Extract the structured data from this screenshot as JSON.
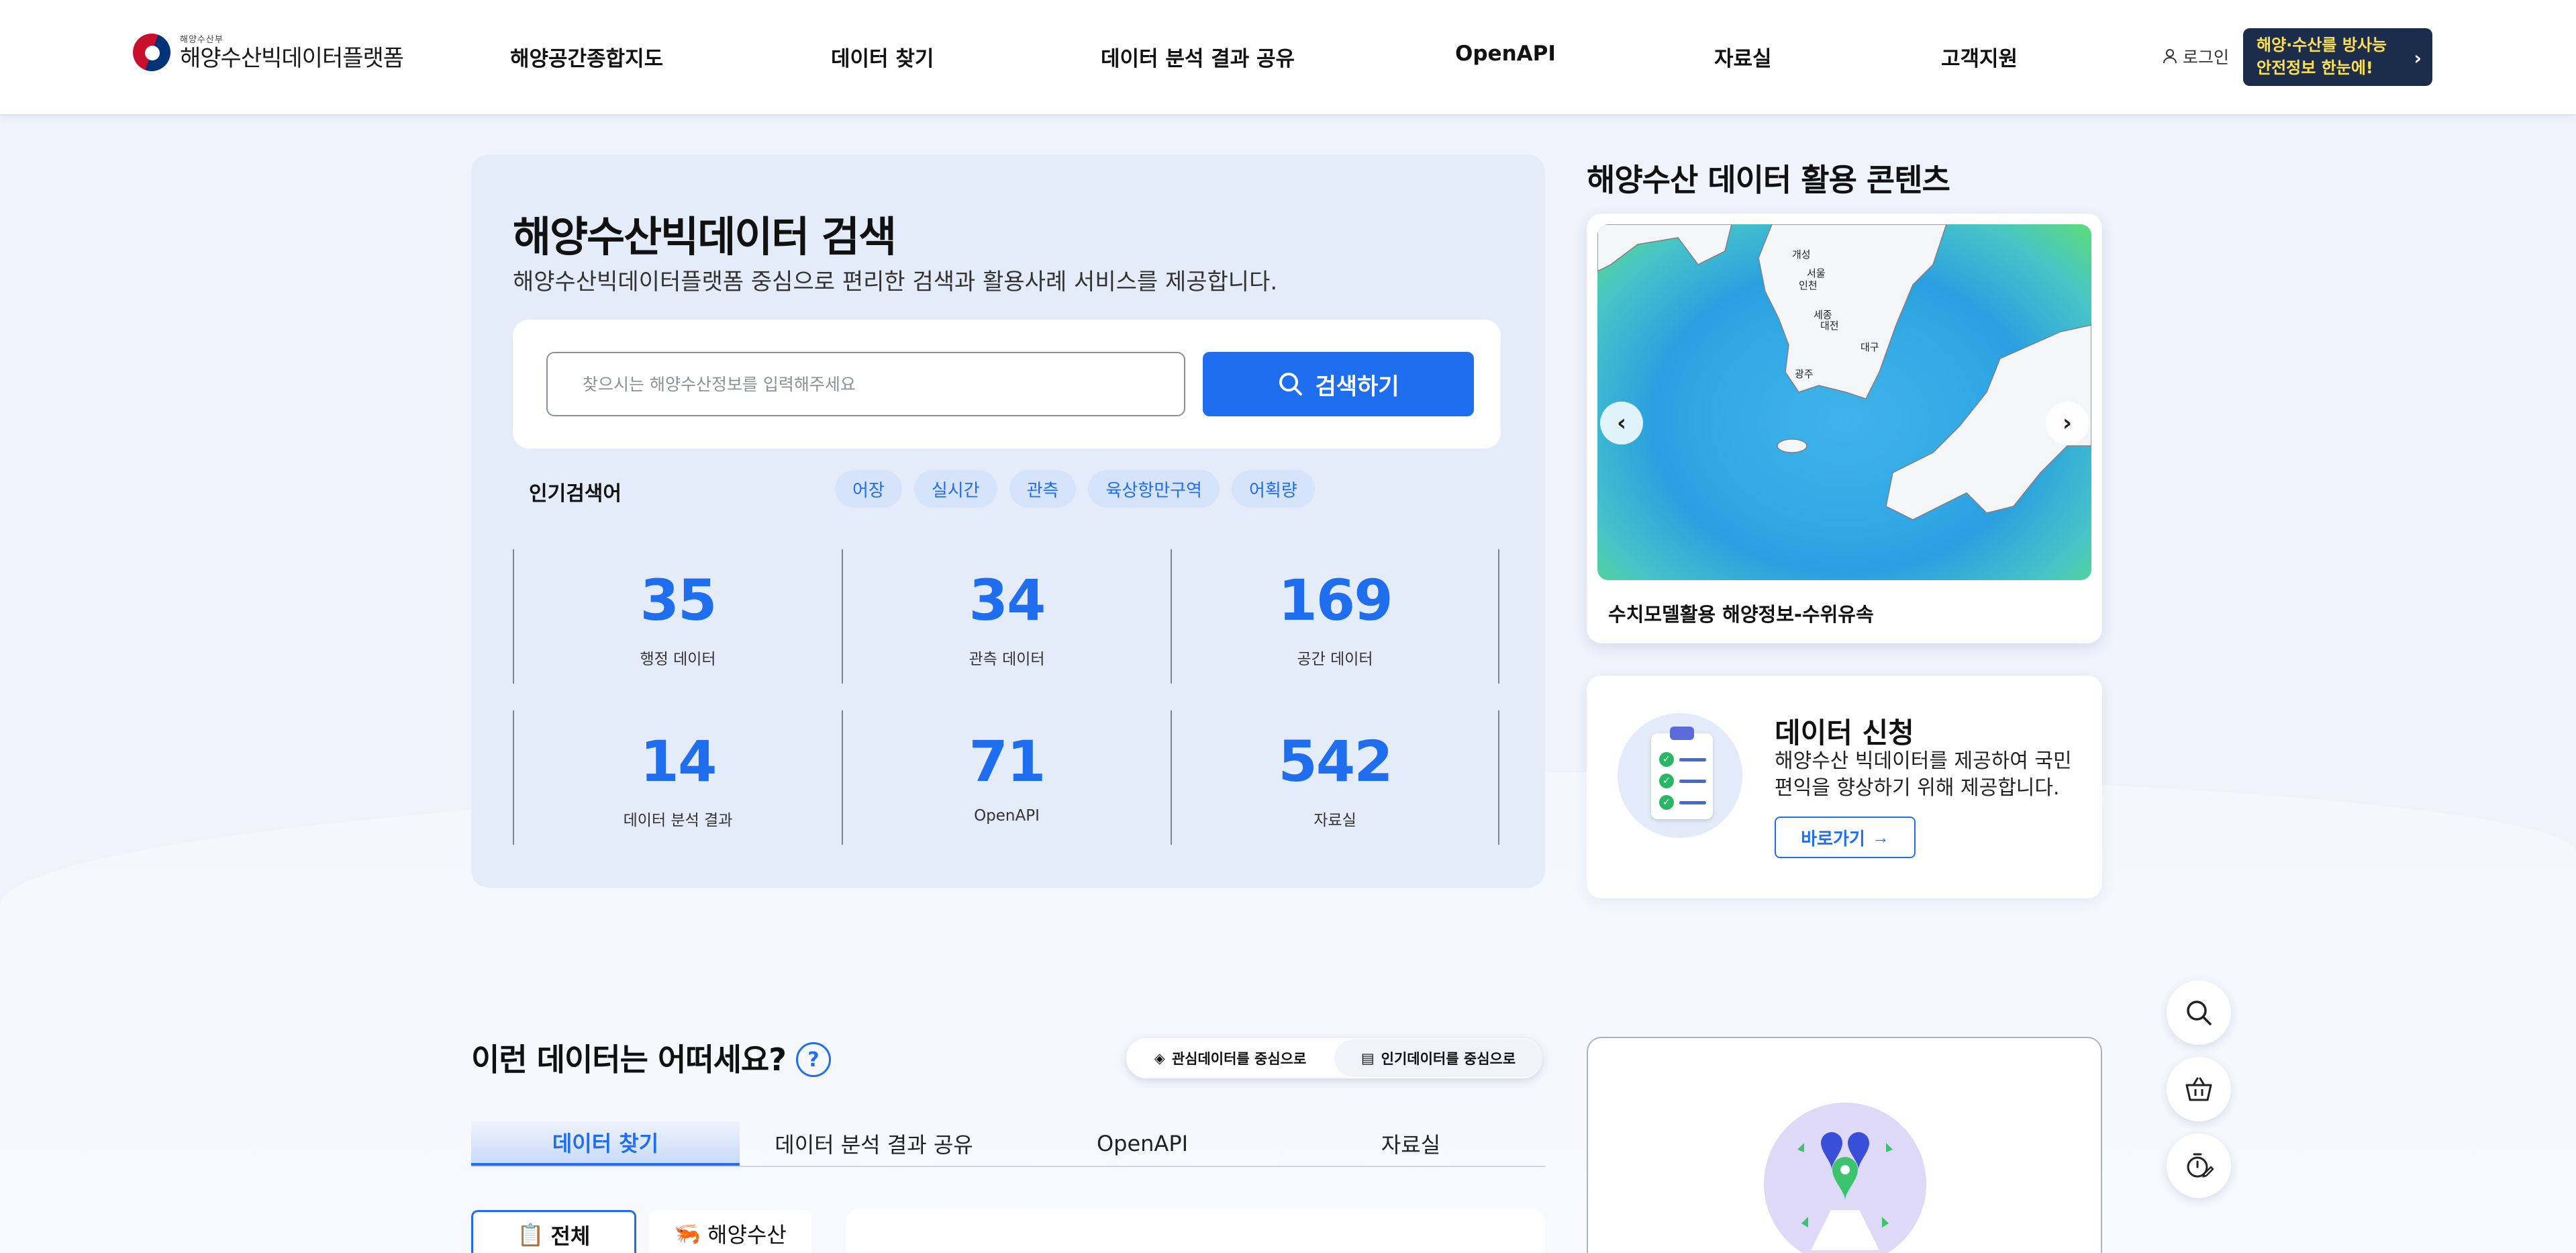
{
  "header": {
    "logo_small": "해양수산부",
    "logo_main": "해양수산빅데이터플랫폼",
    "nav": [
      "해양공간종합지도",
      "데이터 찾기",
      "데이터 분석 결과 공유",
      "OpenAPI",
      "자료실",
      "고객지원"
    ],
    "login": "로그인",
    "banner_line1": "해양·수산를 방사능",
    "banner_line2": "안전정보 한눈에!"
  },
  "search": {
    "title": "해양수산빅데이터 검색",
    "subtitle": "해양수산빅데이터플랫폼 중심으로 편리한 검색과 활용사례 서비스를 제공합니다.",
    "placeholder": "찾으시는 해양수산정보를 입력해주세요",
    "button": "검색하기",
    "popular_label": "인기검색어",
    "popular": [
      "어장",
      "실시간",
      "관측",
      "육상항만구역",
      "어획량"
    ]
  },
  "stats": [
    {
      "value": "35",
      "label": "행정 데이터"
    },
    {
      "value": "34",
      "label": "관측 데이터"
    },
    {
      "value": "169",
      "label": "공간 데이터"
    },
    {
      "value": "14",
      "label": "데이터 분석 결과"
    },
    {
      "value": "71",
      "label": "OpenAPI"
    },
    {
      "value": "542",
      "label": "자료실"
    }
  ],
  "contents": {
    "title": "해양수산 데이터 활용 콘텐츠",
    "caption": "수치모델활용 해양정보-수위유속",
    "map_labels": [
      "개성",
      "서울",
      "인천",
      "세종",
      "대전",
      "대구",
      "광주"
    ]
  },
  "apply": {
    "title": "데이터 신청",
    "desc": "해양수산 빅데이터를 제공하여 국민 편익을 향상하기 위해 제공합니다.",
    "button": "바로가기"
  },
  "recommend": {
    "title": "이런 데이터는 어떠세요?",
    "help": "?",
    "toggle": [
      "관심데이터를 중심으로",
      "인기데이터를 중심으로"
    ],
    "tabs": [
      "데이터 찾기",
      "데이터 분석 결과 공유",
      "OpenAPI",
      "자료실"
    ],
    "categories": [
      "전체",
      "해양수산"
    ]
  },
  "colors": {
    "accent": "#1f6ef0",
    "banner_bg": "#1b2d4a",
    "banner_text": "#ffe14d"
  }
}
